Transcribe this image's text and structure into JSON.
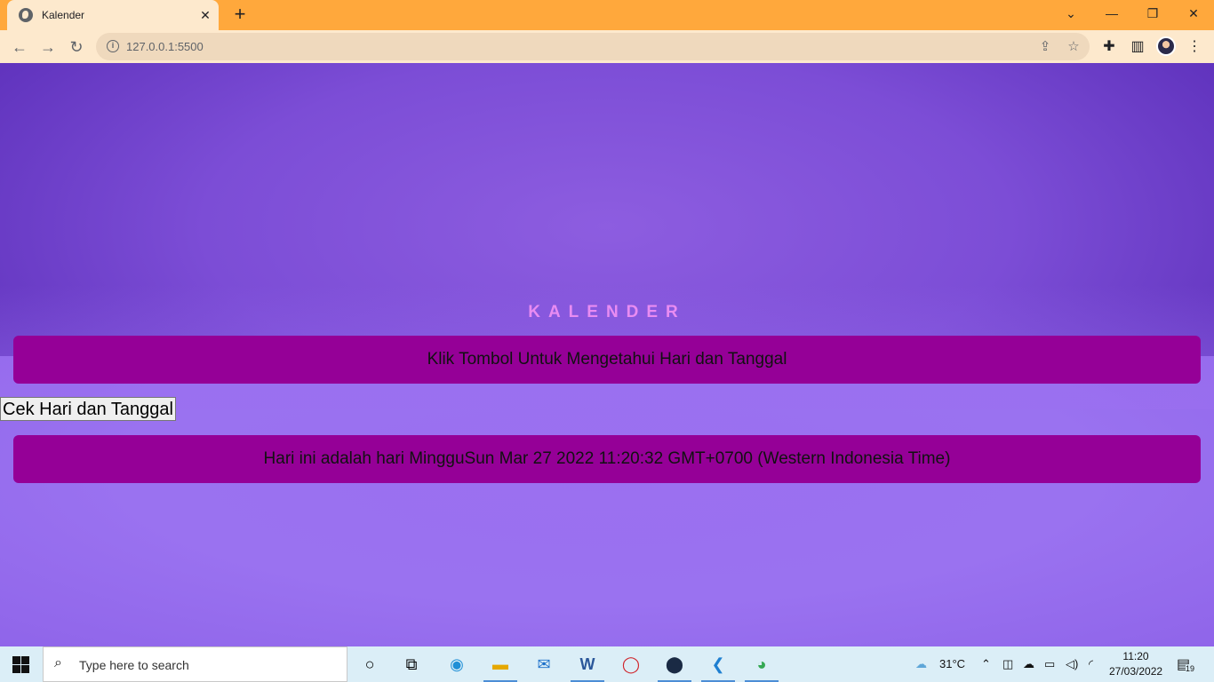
{
  "browser": {
    "tab_title": "Kalender",
    "tab_close": "✕",
    "new_tab": "+",
    "url": "127.0.0.1:5500",
    "window_controls": [
      "⌄",
      "—",
      "❐",
      "✕"
    ]
  },
  "page": {
    "heading": "KALENDER",
    "instruction": "Klik Tombol Untuk Mengetahui Hari dan Tanggal",
    "button_label": "Cek Hari dan Tanggal",
    "result": "Hari ini adalah hari MingguSun Mar 27 2022 11:20:32 GMT+0700 (Western Indonesia Time)"
  },
  "taskbar": {
    "search_placeholder": "Type here to search",
    "weather": "31°C",
    "time": "11:20",
    "date": "27/03/2022",
    "notification_count": "19"
  },
  "colors": {
    "tab_bar": "#ffa83c",
    "toolbar": "#fde9cd",
    "banner": "#950097",
    "heading": "#e98cf2"
  }
}
